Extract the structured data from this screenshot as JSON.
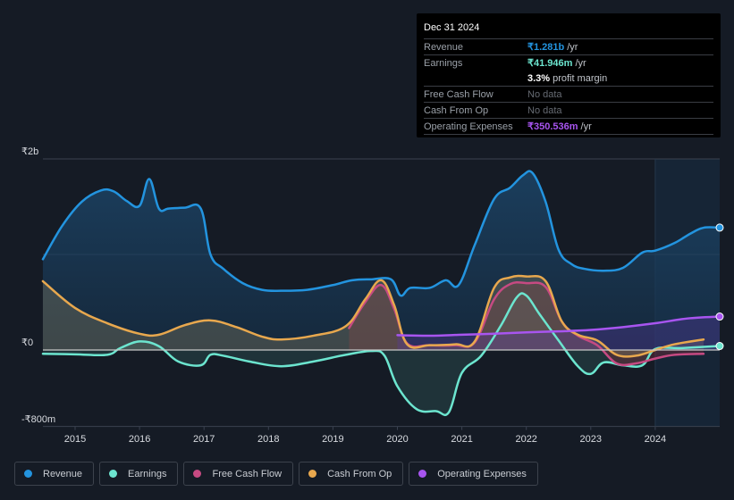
{
  "tooltip": {
    "date": "Dec 31 2024",
    "rows": [
      {
        "label": "Revenue",
        "value": "₹1.281b",
        "unit": "/yr",
        "color": "#2394df"
      },
      {
        "label": "Earnings",
        "value": "₹41.946m",
        "unit": "/yr",
        "color": "#6ce5cf"
      },
      {
        "label": "",
        "value": "3.3%",
        "unit": "profit margin",
        "color": "#ffffff"
      },
      {
        "label": "Free Cash Flow",
        "value": "No data",
        "unit": "",
        "color": "#666b73"
      },
      {
        "label": "Cash From Op",
        "value": "No data",
        "unit": "",
        "color": "#666b73"
      },
      {
        "label": "Operating Expenses",
        "value": "₹350.536m",
        "unit": "/yr",
        "color": "#a855f0"
      }
    ]
  },
  "legend": [
    {
      "label": "Revenue",
      "color": "#2394df"
    },
    {
      "label": "Earnings",
      "color": "#6ce5cf"
    },
    {
      "label": "Free Cash Flow",
      "color": "#c64a82"
    },
    {
      "label": "Cash From Op",
      "color": "#e8a84e"
    },
    {
      "label": "Operating Expenses",
      "color": "#a855f0"
    }
  ],
  "chart_data": {
    "type": "area",
    "title": "",
    "xlabel": "",
    "ylabel": "",
    "currency": "INR",
    "x_ticks": [
      "2015",
      "2016",
      "2017",
      "2018",
      "2019",
      "2020",
      "2021",
      "2022",
      "2023",
      "2024"
    ],
    "y_ticks": [
      {
        "label": "₹2b",
        "value": 2000
      },
      {
        "label": "₹0",
        "value": 0
      },
      {
        "label": "-₹800m",
        "value": -800
      }
    ],
    "ylim": [
      -800,
      2000
    ],
    "xlim": [
      2014.5,
      2025.0
    ],
    "units": "₹ millions",
    "forecast_region_start": 2024.0,
    "series": [
      {
        "name": "Revenue",
        "color": "#2394df",
        "x": [
          2014.5,
          2014.8,
          2015.1,
          2015.4,
          2015.6,
          2015.8,
          2016.0,
          2016.15,
          2016.3,
          2016.45,
          2016.7,
          2016.95,
          2017.1,
          2017.3,
          2017.6,
          2017.9,
          2018.2,
          2018.6,
          2019.0,
          2019.3,
          2019.6,
          2019.9,
          2020.05,
          2020.2,
          2020.5,
          2020.75,
          2020.95,
          2021.2,
          2021.5,
          2021.75,
          2021.95,
          2022.1,
          2022.3,
          2022.5,
          2022.7,
          2022.9,
          2023.2,
          2023.5,
          2023.8,
          2024.0,
          2024.3,
          2024.55,
          2024.75,
          2025.0
        ],
        "values": [
          950,
          1300,
          1550,
          1670,
          1660,
          1560,
          1510,
          1790,
          1480,
          1480,
          1490,
          1480,
          1000,
          850,
          700,
          630,
          620,
          630,
          680,
          730,
          740,
          740,
          570,
          650,
          650,
          730,
          680,
          1100,
          1580,
          1700,
          1830,
          1850,
          1550,
          1050,
          900,
          850,
          830,
          860,
          1020,
          1040,
          1120,
          1220,
          1280,
          1281
        ]
      },
      {
        "name": "Earnings",
        "color": "#6ce5cf",
        "x": [
          2014.5,
          2015.0,
          2015.5,
          2015.7,
          2016.0,
          2016.3,
          2016.6,
          2016.95,
          2017.1,
          2017.3,
          2017.7,
          2018.2,
          2018.7,
          2019.2,
          2019.6,
          2019.8,
          2020.0,
          2020.3,
          2020.6,
          2020.8,
          2021.0,
          2021.3,
          2021.6,
          2021.85,
          2022.0,
          2022.2,
          2022.5,
          2022.8,
          2023.0,
          2023.2,
          2023.5,
          2023.8,
          2024.0,
          2024.4,
          2025.0
        ],
        "values": [
          -40,
          -45,
          -50,
          20,
          90,
          40,
          -120,
          -160,
          -50,
          -60,
          -120,
          -170,
          -120,
          -50,
          -10,
          -60,
          -380,
          -620,
          -640,
          -650,
          -240,
          -60,
          250,
          550,
          570,
          380,
          100,
          -170,
          -250,
          -130,
          -160,
          -160,
          10,
          20,
          42
        ]
      },
      {
        "name": "Free Cash Flow",
        "color": "#c64a82",
        "x": [
          2019.25,
          2019.5,
          2019.75,
          2019.95,
          2020.15,
          2020.5,
          2020.9,
          2021.2,
          2021.5,
          2021.75,
          2022.0,
          2022.3,
          2022.55,
          2022.8,
          2023.1,
          2023.4,
          2023.7,
          2024.0,
          2024.3,
          2024.75
        ],
        "values": [
          230,
          500,
          680,
          430,
          70,
          50,
          50,
          80,
          530,
          690,
          700,
          660,
          300,
          150,
          50,
          -140,
          -140,
          -90,
          -50,
          -40
        ]
      },
      {
        "name": "Cash From Op",
        "color": "#e8a84e",
        "x": [
          2014.5,
          2015.0,
          2015.5,
          2016.0,
          2016.3,
          2016.7,
          2017.1,
          2017.5,
          2017.9,
          2018.2,
          2018.7,
          2019.2,
          2019.5,
          2019.75,
          2019.95,
          2020.15,
          2020.5,
          2020.9,
          2021.2,
          2021.5,
          2021.75,
          2022.0,
          2022.3,
          2022.55,
          2022.8,
          2023.1,
          2023.4,
          2023.7,
          2024.0,
          2024.3,
          2024.75
        ],
        "values": [
          720,
          440,
          280,
          170,
          160,
          260,
          310,
          240,
          140,
          110,
          150,
          250,
          530,
          730,
          470,
          60,
          50,
          60,
          90,
          650,
          760,
          770,
          720,
          300,
          160,
          100,
          -50,
          -60,
          0,
          60,
          110
        ]
      },
      {
        "name": "Operating Expenses",
        "color": "#a855f0",
        "x": [
          2020.0,
          2020.5,
          2021.0,
          2021.5,
          2022.0,
          2022.5,
          2023.0,
          2023.5,
          2024.0,
          2024.5,
          2025.0
        ],
        "values": [
          155,
          150,
          160,
          170,
          185,
          195,
          210,
          240,
          280,
          330,
          350
        ]
      }
    ]
  }
}
